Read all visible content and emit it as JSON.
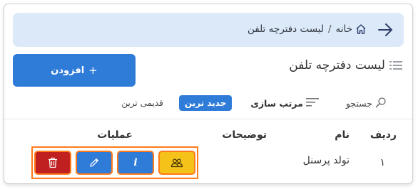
{
  "breadcrumb": {
    "home_label": "خانه",
    "separator": "/",
    "current_label": "لیست دفترچه تلفن"
  },
  "page": {
    "title": "لیست دفترچه تلفن",
    "add_button_label": "افزودن",
    "add_button_plus": "+"
  },
  "toolbar": {
    "search_label": "جستجو",
    "sort_label": "مرتب سازی",
    "newest_label": "جدید ترین",
    "oldest_label": "قدیمی ترین"
  },
  "table": {
    "headers": {
      "row": "ردیف",
      "name": "نام",
      "description": "توضیحات",
      "actions": "عملیات"
    },
    "rows": [
      {
        "index": "۱",
        "name": "تولد پرسنل",
        "description": ""
      }
    ]
  },
  "colors": {
    "primary": "#2f7bd8",
    "danger": "#c0201f",
    "warning": "#f5c21a",
    "highlight": "#ff7a1a",
    "breadcrumb_bg": "#dbe9f9"
  },
  "icons": {
    "back": "arrow-right-icon",
    "home": "home-icon",
    "title": "list-icon",
    "search": "search-icon",
    "sort": "sort-icon",
    "delete": "trash-icon",
    "edit": "pencil-icon",
    "info": "info-icon",
    "group": "users-icon"
  }
}
